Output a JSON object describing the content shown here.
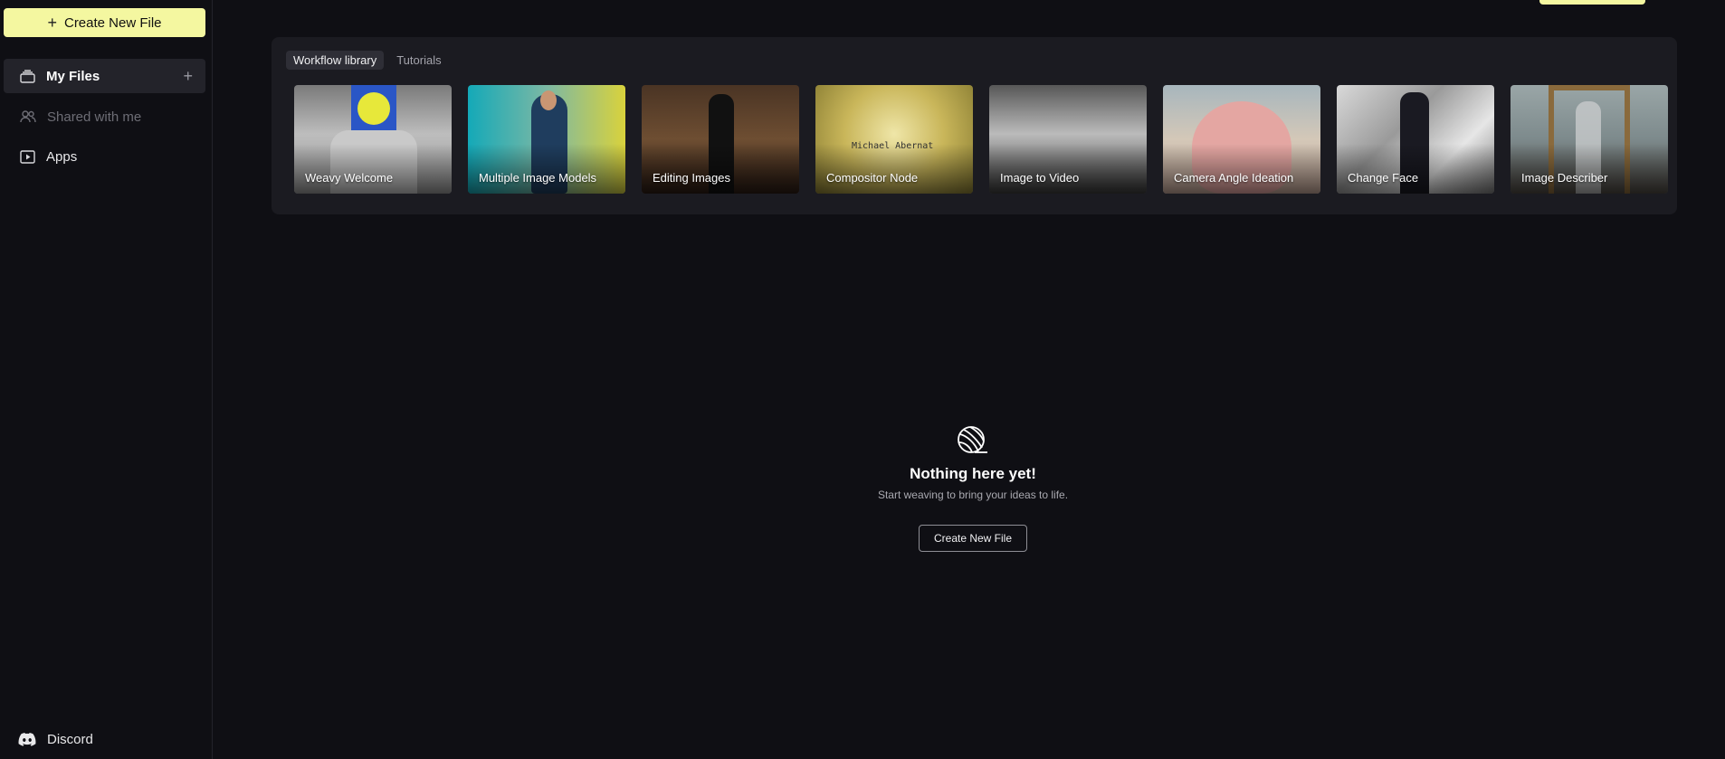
{
  "sidebar": {
    "create_label": "Create New File",
    "items": [
      {
        "label": "My Files",
        "icon": "files-icon",
        "active": true
      },
      {
        "label": "Shared with me",
        "icon": "users-icon",
        "active": false
      },
      {
        "label": "Apps",
        "icon": "play-square-icon",
        "active": false
      }
    ],
    "footer_label": "Discord"
  },
  "library": {
    "tabs": [
      {
        "label": "Workflow library",
        "active": true
      },
      {
        "label": "Tutorials",
        "active": false
      }
    ],
    "cards": [
      {
        "label": "Weavy Welcome"
      },
      {
        "label": "Multiple Image Models"
      },
      {
        "label": "Editing Images"
      },
      {
        "label": "Compositor Node",
        "image_text": "Michael Abernat"
      },
      {
        "label": "Image to Video"
      },
      {
        "label": "Camera Angle Ideation"
      },
      {
        "label": "Change Face"
      },
      {
        "label": "Image Describer"
      }
    ]
  },
  "empty_state": {
    "icon": "yarn-ball-icon",
    "title": "Nothing here yet!",
    "subtitle": "Start weaving to bring your ideas to life.",
    "cta_label": "Create New File"
  },
  "colors": {
    "accent": "#f4f7a0",
    "background": "#0f0f14",
    "panel": "#1b1b21"
  }
}
